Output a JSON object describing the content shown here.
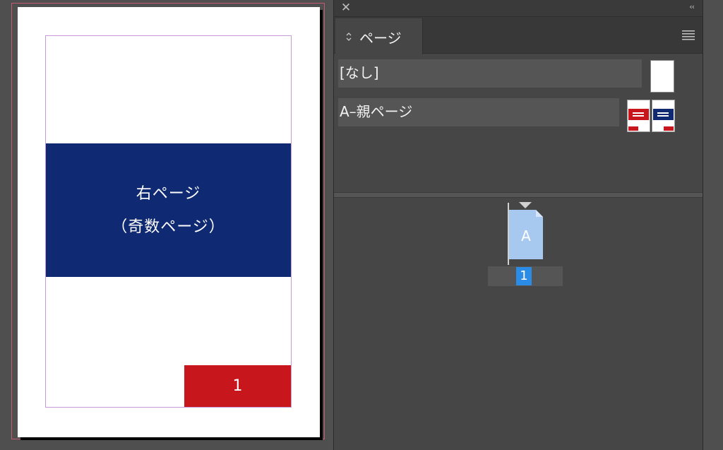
{
  "document": {
    "right_page_title": "右ページ",
    "right_page_subtitle": "（奇数ページ）",
    "page_number": "1"
  },
  "panel": {
    "tab_label": "ページ",
    "close_icon": "close-icon",
    "collapse_icon": "double-chevron-icon",
    "menu_icon": "hamburger-menu-icon",
    "parents": [
      {
        "label": "[なし]"
      },
      {
        "label": "A–親ページ"
      }
    ],
    "pages": [
      {
        "prefix": "A",
        "number": "1",
        "selected": true
      }
    ]
  },
  "colors": {
    "blue_block": "#0f2a72",
    "red_block": "#c8161d",
    "selection": "#2b8ce8",
    "page_thumb": "#a7c8ef"
  }
}
